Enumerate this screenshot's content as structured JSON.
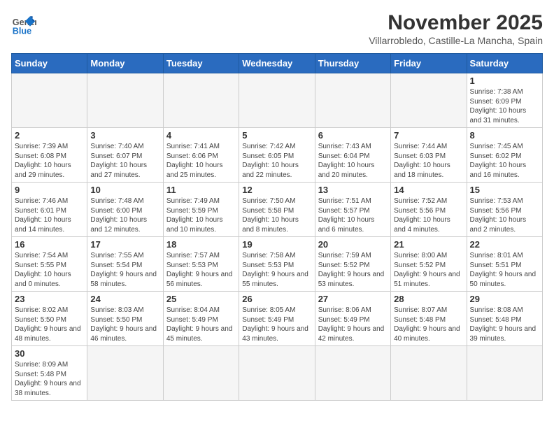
{
  "header": {
    "logo_general": "General",
    "logo_blue": "Blue",
    "month_title": "November 2025",
    "location": "Villarrobledo, Castille-La Mancha, Spain"
  },
  "weekdays": [
    "Sunday",
    "Monday",
    "Tuesday",
    "Wednesday",
    "Thursday",
    "Friday",
    "Saturday"
  ],
  "weeks": [
    [
      {
        "day": "",
        "info": ""
      },
      {
        "day": "",
        "info": ""
      },
      {
        "day": "",
        "info": ""
      },
      {
        "day": "",
        "info": ""
      },
      {
        "day": "",
        "info": ""
      },
      {
        "day": "",
        "info": ""
      },
      {
        "day": "1",
        "info": "Sunrise: 7:38 AM\nSunset: 6:09 PM\nDaylight: 10 hours and 31 minutes."
      }
    ],
    [
      {
        "day": "2",
        "info": "Sunrise: 7:39 AM\nSunset: 6:08 PM\nDaylight: 10 hours and 29 minutes."
      },
      {
        "day": "3",
        "info": "Sunrise: 7:40 AM\nSunset: 6:07 PM\nDaylight: 10 hours and 27 minutes."
      },
      {
        "day": "4",
        "info": "Sunrise: 7:41 AM\nSunset: 6:06 PM\nDaylight: 10 hours and 25 minutes."
      },
      {
        "day": "5",
        "info": "Sunrise: 7:42 AM\nSunset: 6:05 PM\nDaylight: 10 hours and 22 minutes."
      },
      {
        "day": "6",
        "info": "Sunrise: 7:43 AM\nSunset: 6:04 PM\nDaylight: 10 hours and 20 minutes."
      },
      {
        "day": "7",
        "info": "Sunrise: 7:44 AM\nSunset: 6:03 PM\nDaylight: 10 hours and 18 minutes."
      },
      {
        "day": "8",
        "info": "Sunrise: 7:45 AM\nSunset: 6:02 PM\nDaylight: 10 hours and 16 minutes."
      }
    ],
    [
      {
        "day": "9",
        "info": "Sunrise: 7:46 AM\nSunset: 6:01 PM\nDaylight: 10 hours and 14 minutes."
      },
      {
        "day": "10",
        "info": "Sunrise: 7:48 AM\nSunset: 6:00 PM\nDaylight: 10 hours and 12 minutes."
      },
      {
        "day": "11",
        "info": "Sunrise: 7:49 AM\nSunset: 5:59 PM\nDaylight: 10 hours and 10 minutes."
      },
      {
        "day": "12",
        "info": "Sunrise: 7:50 AM\nSunset: 5:58 PM\nDaylight: 10 hours and 8 minutes."
      },
      {
        "day": "13",
        "info": "Sunrise: 7:51 AM\nSunset: 5:57 PM\nDaylight: 10 hours and 6 minutes."
      },
      {
        "day": "14",
        "info": "Sunrise: 7:52 AM\nSunset: 5:56 PM\nDaylight: 10 hours and 4 minutes."
      },
      {
        "day": "15",
        "info": "Sunrise: 7:53 AM\nSunset: 5:56 PM\nDaylight: 10 hours and 2 minutes."
      }
    ],
    [
      {
        "day": "16",
        "info": "Sunrise: 7:54 AM\nSunset: 5:55 PM\nDaylight: 10 hours and 0 minutes."
      },
      {
        "day": "17",
        "info": "Sunrise: 7:55 AM\nSunset: 5:54 PM\nDaylight: 9 hours and 58 minutes."
      },
      {
        "day": "18",
        "info": "Sunrise: 7:57 AM\nSunset: 5:53 PM\nDaylight: 9 hours and 56 minutes."
      },
      {
        "day": "19",
        "info": "Sunrise: 7:58 AM\nSunset: 5:53 PM\nDaylight: 9 hours and 55 minutes."
      },
      {
        "day": "20",
        "info": "Sunrise: 7:59 AM\nSunset: 5:52 PM\nDaylight: 9 hours and 53 minutes."
      },
      {
        "day": "21",
        "info": "Sunrise: 8:00 AM\nSunset: 5:52 PM\nDaylight: 9 hours and 51 minutes."
      },
      {
        "day": "22",
        "info": "Sunrise: 8:01 AM\nSunset: 5:51 PM\nDaylight: 9 hours and 50 minutes."
      }
    ],
    [
      {
        "day": "23",
        "info": "Sunrise: 8:02 AM\nSunset: 5:50 PM\nDaylight: 9 hours and 48 minutes."
      },
      {
        "day": "24",
        "info": "Sunrise: 8:03 AM\nSunset: 5:50 PM\nDaylight: 9 hours and 46 minutes."
      },
      {
        "day": "25",
        "info": "Sunrise: 8:04 AM\nSunset: 5:49 PM\nDaylight: 9 hours and 45 minutes."
      },
      {
        "day": "26",
        "info": "Sunrise: 8:05 AM\nSunset: 5:49 PM\nDaylight: 9 hours and 43 minutes."
      },
      {
        "day": "27",
        "info": "Sunrise: 8:06 AM\nSunset: 5:49 PM\nDaylight: 9 hours and 42 minutes."
      },
      {
        "day": "28",
        "info": "Sunrise: 8:07 AM\nSunset: 5:48 PM\nDaylight: 9 hours and 40 minutes."
      },
      {
        "day": "29",
        "info": "Sunrise: 8:08 AM\nSunset: 5:48 PM\nDaylight: 9 hours and 39 minutes."
      }
    ],
    [
      {
        "day": "30",
        "info": "Sunrise: 8:09 AM\nSunset: 5:48 PM\nDaylight: 9 hours and 38 minutes."
      },
      {
        "day": "",
        "info": ""
      },
      {
        "day": "",
        "info": ""
      },
      {
        "day": "",
        "info": ""
      },
      {
        "day": "",
        "info": ""
      },
      {
        "day": "",
        "info": ""
      },
      {
        "day": "",
        "info": ""
      }
    ]
  ]
}
